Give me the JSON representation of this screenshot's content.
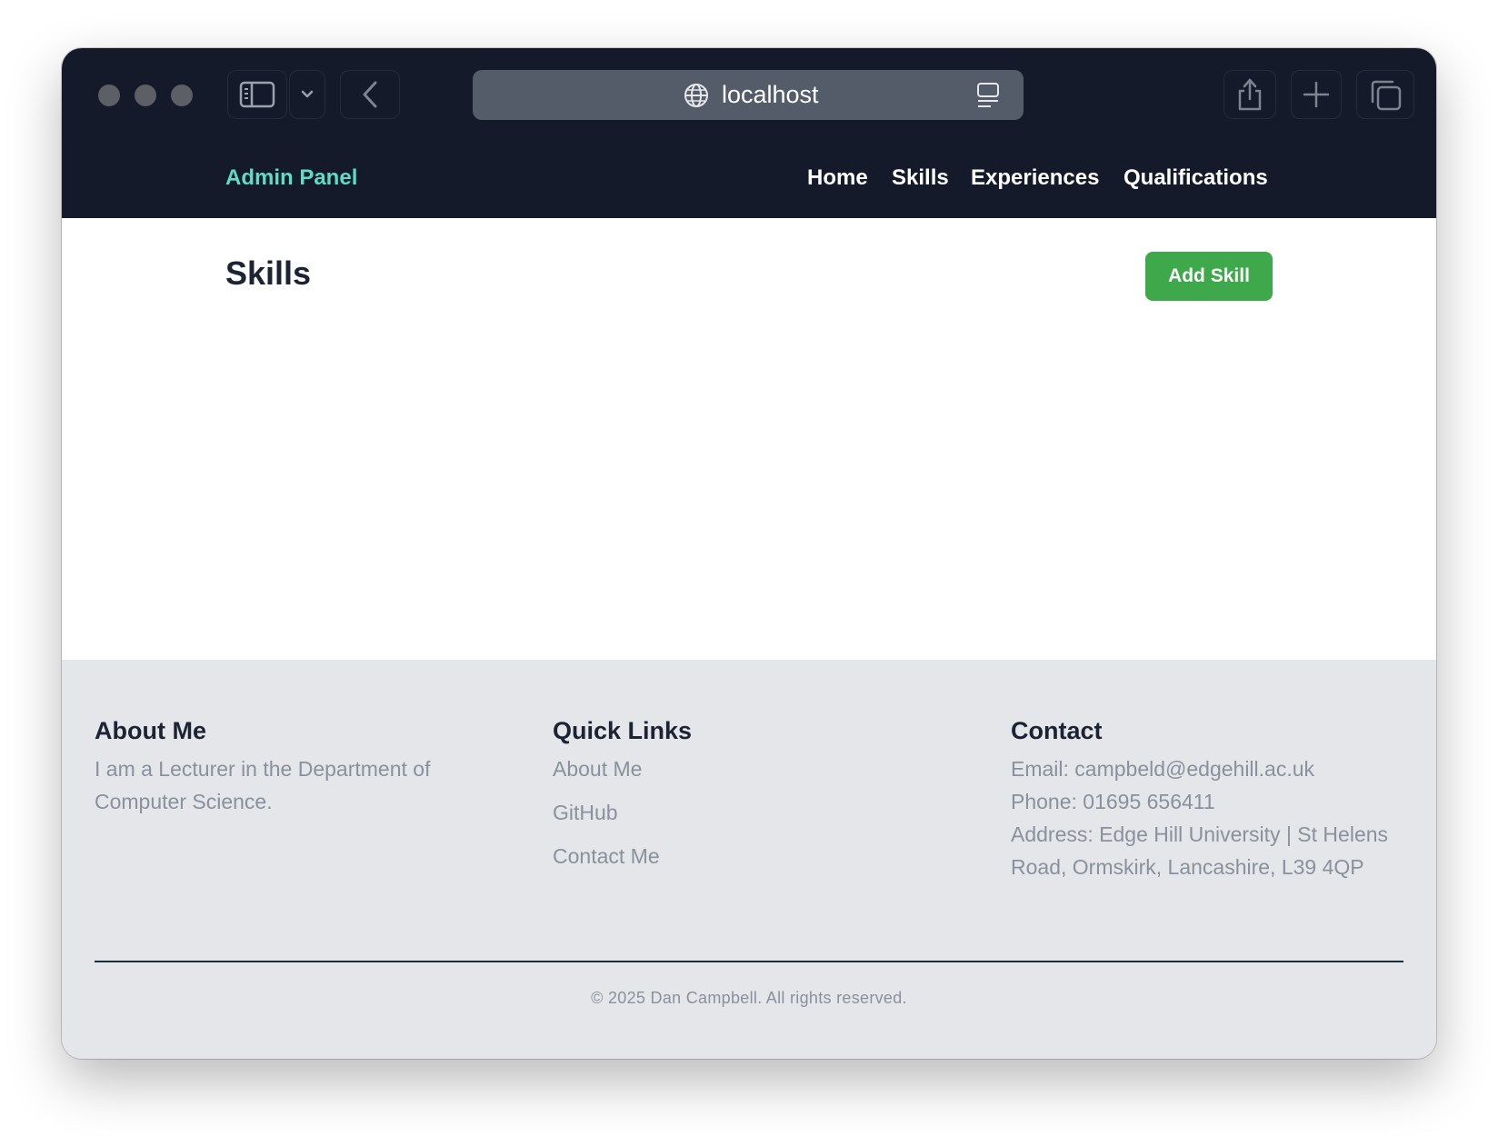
{
  "browser": {
    "url": "localhost"
  },
  "nav": {
    "brand": "Admin Panel",
    "links": [
      "Home",
      "Skills",
      "Experiences",
      "Qualifications"
    ]
  },
  "main": {
    "title": "Skills",
    "add_button": "Add Skill"
  },
  "footer": {
    "about": {
      "heading": "About Me",
      "text": "I am a Lecturer in the Department of Computer Science."
    },
    "quick_links": {
      "heading": "Quick Links",
      "links": [
        "About Me",
        "GitHub",
        "Contact Me"
      ]
    },
    "contact": {
      "heading": "Contact",
      "email": "Email: campbeld@edgehill.ac.uk",
      "phone": "Phone: 01695 656411",
      "address": "Address: Edge Hill University | St Helens Road, Ormskirk, Lancashire, L39 4QP"
    },
    "copyright": "© 2025 Dan Campbell. All rights reserved."
  },
  "colors": {
    "chrome_bg": "#141a29",
    "brand": "#5fdcc4",
    "add_button": "#3ea94b",
    "footer_bg": "#e4e6ea",
    "muted_text": "#8a909c",
    "heading_text": "#1c2433"
  },
  "icons": {
    "sidebar": "sidebar-icon",
    "chevron": "chevron-down-icon",
    "back": "back-arrow-icon",
    "globe": "globe-icon",
    "reader": "reader-mode-icon",
    "share": "share-icon",
    "new_tab": "plus-icon",
    "tabs": "tab-overview-icon"
  }
}
